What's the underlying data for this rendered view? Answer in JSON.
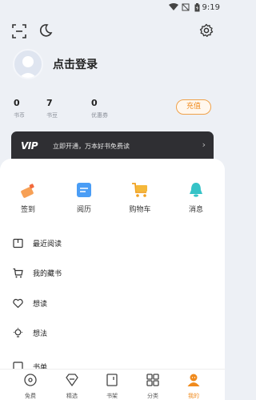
{
  "status": {
    "time": "9:19"
  },
  "profile": {
    "login_label": "点击登录"
  },
  "stats": [
    {
      "value": "0",
      "label": "书币"
    },
    {
      "value": "7",
      "label": "书豆"
    },
    {
      "value": "0",
      "label": "优惠券"
    }
  ],
  "recharge_label": "充值",
  "vip": {
    "logo": "VIP",
    "text": "立即开通，万本好书免费读"
  },
  "quick_actions": [
    {
      "label": "签到",
      "icon": "pencil-icon"
    },
    {
      "label": "阅历",
      "icon": "document-icon"
    },
    {
      "label": "购物车",
      "icon": "cart-icon"
    },
    {
      "label": "消息",
      "icon": "bell-icon"
    }
  ],
  "menu": [
    {
      "label": "最近阅读",
      "icon": "book-icon"
    },
    {
      "label": "我的藏书",
      "icon": "cart-outline-icon"
    },
    {
      "label": "想读",
      "icon": "heart-icon"
    },
    {
      "label": "想法",
      "icon": "bulb-icon"
    },
    {
      "label": "书单",
      "icon": "list-icon"
    }
  ],
  "tabs": [
    {
      "label": "免费",
      "active": false
    },
    {
      "label": "精选",
      "active": false
    },
    {
      "label": "书架",
      "active": false
    },
    {
      "label": "分类",
      "active": false
    },
    {
      "label": "我的",
      "active": true
    }
  ],
  "colors": {
    "accent": "#f08a1c",
    "vip_bg": "#2f2f33",
    "page_bg": "#edf0f5"
  }
}
